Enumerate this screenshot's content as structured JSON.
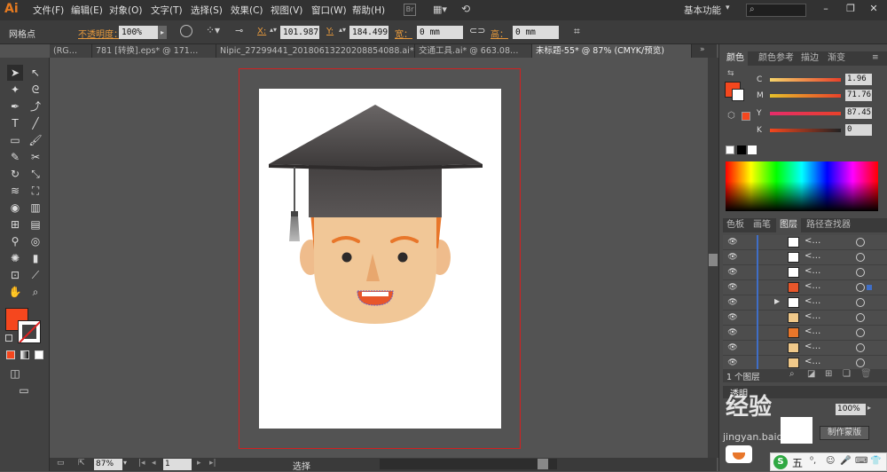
{
  "app": {
    "logo": "Ai"
  },
  "menu": [
    "文件(F)",
    "编辑(E)",
    "对象(O)",
    "文字(T)",
    "选择(S)",
    "效果(C)",
    "视图(V)",
    "窗口(W)",
    "帮助(H)"
  ],
  "workspace": "基本功能",
  "control": {
    "mode_label": "网格点",
    "opacity_label": "不透明度：",
    "opacity_value": "100%",
    "x_label": "X:",
    "x_value": "101.987",
    "y_label": "Y:",
    "y_value": "184.499",
    "w_label": "宽：",
    "w_value": "0 mm",
    "h_label": "高：",
    "h_value": "0 mm"
  },
  "tabs": [
    {
      "label": "(RG…",
      "active": false
    },
    {
      "label": "781 [转换].eps* @ 171…",
      "active": false
    },
    {
      "label": "Nipic_27299441_20180613220208854088.ai* ×",
      "active": false
    },
    {
      "label": "交通工具.ai* @ 663.08…",
      "active": false
    },
    {
      "label": "未标题-55* @ 87% (CMYK/预览)",
      "active": true
    }
  ],
  "color_panel": {
    "tabs": [
      "颜色",
      "颜色参考",
      "描边",
      "渐变"
    ],
    "channels": [
      {
        "name": "C",
        "value": "1.96",
        "color": "#e8412a"
      },
      {
        "name": "M",
        "value": "71.76",
        "color": "#e6c12a"
      },
      {
        "name": "Y",
        "value": "87.45",
        "color": "#e52c6b"
      },
      {
        "name": "K",
        "value": "0",
        "color": "#555555"
      }
    ],
    "fill_color": "#f5471e"
  },
  "layers_panel": {
    "tabs": [
      "色板",
      "画笔",
      "图层",
      "路径查找器"
    ],
    "footer": "1 个图层",
    "rows": [
      {
        "name": "<…",
        "thumb": "#ffffff"
      },
      {
        "name": "<…",
        "thumb": "#ffffff"
      },
      {
        "name": "<…",
        "thumb": "#ffffff"
      },
      {
        "name": "<…",
        "thumb": "#e8562a"
      },
      {
        "name": "<…",
        "thumb": "#ffffff"
      },
      {
        "name": "<…",
        "thumb": "#f0c98a"
      },
      {
        "name": "<…",
        "thumb": "#e8762a"
      },
      {
        "name": "<…",
        "thumb": "#f0c98a"
      },
      {
        "name": "<…",
        "thumb": "#f0c98a"
      }
    ]
  },
  "transparency": {
    "tab": "透明",
    "value": "100%",
    "mask_button": "制作蒙版"
  },
  "status": {
    "zoom": "87%",
    "page": "1",
    "tool": "选择"
  },
  "watermark": {
    "text": "经验",
    "sub": "jingyan.baidu.com"
  },
  "ime": {
    "label": "五"
  }
}
